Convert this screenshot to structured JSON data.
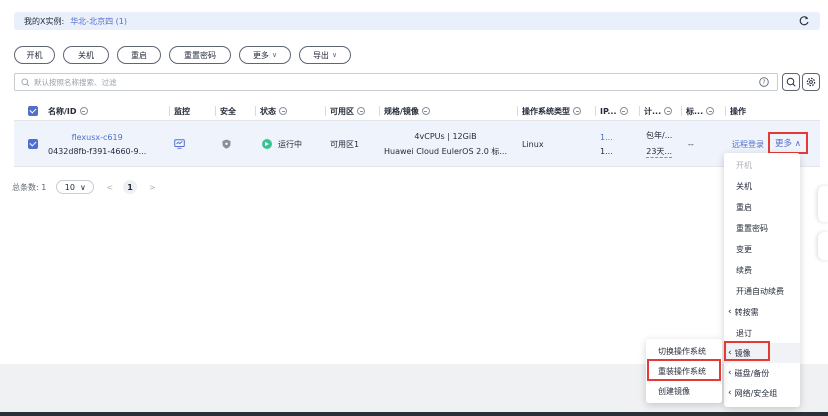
{
  "region": {
    "label": "我的X实例:",
    "value": "华北-北京四 (1)"
  },
  "toolbar": [
    {
      "label": "开机",
      "caret": ""
    },
    {
      "label": "关机",
      "caret": ""
    },
    {
      "label": "重启",
      "caret": ""
    },
    {
      "label": "重置密码",
      "caret": ""
    },
    {
      "label": "更多",
      "caret": "∨"
    },
    {
      "label": "导出",
      "caret": "∨"
    }
  ],
  "search": {
    "placeholder": "默认按照名称搜索、过滤"
  },
  "table": {
    "headers": [
      "名称/ID",
      "监控",
      "安全",
      "状态",
      "可用区",
      "规格/镜像",
      "操作系统类型",
      "IP...",
      "计...",
      "标...",
      "操作"
    ],
    "row": {
      "name": "flexusx-c619",
      "id": "0432d8fb-f391-4660-9...",
      "status": "运行中",
      "zone": "可用区1",
      "spec_line1": "4vCPUs | 12GiB",
      "spec_line2": "Huawei Cloud EulerOS 2.0 标...",
      "os": "Linux",
      "ip_line1": "1...",
      "ip_line2": "1...",
      "billing_line1": "包年/...",
      "billing_line2": "23天...",
      "tag": "--",
      "action_login": "远程登录",
      "action_more": "更多 ∧"
    }
  },
  "pager": {
    "total": "总条数: 1",
    "size": "10",
    "size_caret": "∨",
    "prev": "<",
    "page": "1",
    "next": ">"
  },
  "more_menu": [
    {
      "label": "开机",
      "disabled": true
    },
    {
      "label": "关机"
    },
    {
      "label": "重启"
    },
    {
      "label": "重置密码"
    },
    {
      "label": "变更"
    },
    {
      "label": "续费"
    },
    {
      "label": "开通自动续费"
    },
    {
      "label": "转按需",
      "sub": true
    },
    {
      "label": "退订"
    },
    {
      "label": "镜像",
      "sub": true
    },
    {
      "label": "磁盘/备份",
      "sub": true
    },
    {
      "label": "网络/安全组",
      "sub": true
    }
  ],
  "image_submenu": [
    "切换操作系统",
    "重装操作系统",
    "创建镜像"
  ],
  "colors": {
    "accent": "#526ecc",
    "running": "#3ac295",
    "highlight": "#e53935"
  }
}
